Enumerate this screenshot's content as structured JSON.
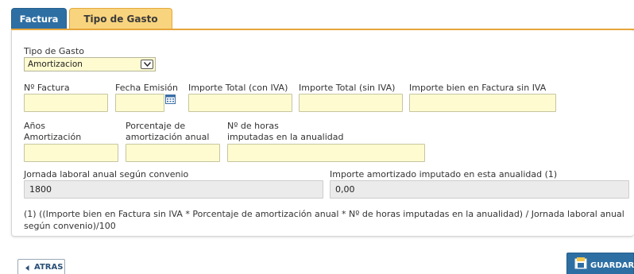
{
  "tabs": [
    {
      "label": "Factura"
    },
    {
      "label": "Tipo de Gasto"
    }
  ],
  "form": {
    "tipo_gasto_label": "Tipo de Gasto",
    "tipo_gasto_value": "Amortizacion",
    "n_factura_label": "Nº Factura",
    "fecha_emision_label": "Fecha Emisión",
    "importe_con_iva_label": "Importe Total (con IVA)",
    "importe_sin_iva_label": "Importe Total (sin IVA)",
    "importe_bien_label": "Importe bien en Factura sin IVA",
    "anos_label_1": "Años",
    "anos_label_2": "Amortización",
    "porcentaje_label_1": "Porcentaje de",
    "porcentaje_label_2": "amortización anual",
    "horas_label_1": "Nº de horas",
    "horas_label_2": "imputadas en la anualidad",
    "jornada_label": "Jornada laboral anual según convenio",
    "jornada_value": "1800",
    "importe_amortizado_label": "Importe amortizado imputado en esta anualidad (1)",
    "importe_amortizado_value": "0,00",
    "note": "(1) ((Importe bien en Factura sin IVA * Porcentaje de amortización anual * Nº de horas imputadas en la anualidad) / Jornada laboral anual según convenio)/100"
  },
  "buttons": {
    "back_label": "ATRAS",
    "save_label": "GUARDAR"
  },
  "icons": {
    "calendar": "calendar-icon",
    "back_arrow": "arrow-left-icon",
    "save": "save-icon",
    "dropdown": "chevron-down-icon"
  },
  "colors": {
    "tab_active_bg": "#f9d47e",
    "tab_inactive_bg": "#2e6fa3",
    "input_bg": "#fefbd0",
    "readonly_bg": "#ebebeb",
    "save_button_bg": "#2e6fa3"
  }
}
